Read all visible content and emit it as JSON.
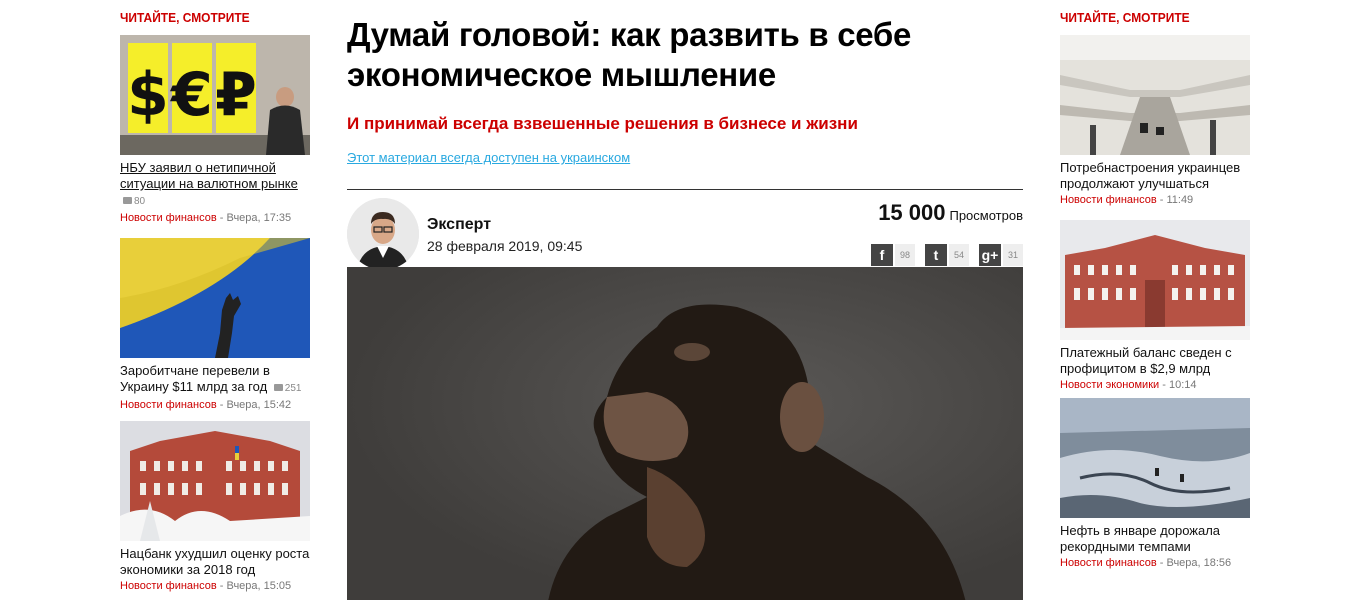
{
  "left": {
    "heading": "ЧИТАЙТЕ, СМОТРИТЕ",
    "items": [
      {
        "title": "НБУ заявил о нетипичной ситуации на валютном рынке",
        "comments": "80",
        "category": "Новости финансов",
        "sep": " - ",
        "time": "Вчера, 17:35"
      },
      {
        "title": "Заробитчане перевели в Украину $11 млрд за год",
        "comments": "251",
        "category": "Новости финансов",
        "sep": " - ",
        "time": "Вчера, 15:42"
      },
      {
        "title": "Нацбанк ухудшил оценку роста экономики за 2018 год",
        "comments": "",
        "category": "Новости финансов",
        "sep": " - ",
        "time": "Вчера, 15:05"
      }
    ]
  },
  "right": {
    "heading": "ЧИТАЙТЕ, СМОТРИТЕ",
    "items": [
      {
        "title": "Потребнастроения украинцев продолжают улучшаться",
        "category": "Новости финансов",
        "sep": " - ",
        "time": "11:49"
      },
      {
        "title": "Платежный баланс сведен с профицитом в $2,9 млрд",
        "category": "Новости экономики",
        "sep": " - ",
        "time": "10:14"
      },
      {
        "title": "Нефть в январе дорожала рекордными темпами",
        "category": "Новости финансов",
        "sep": " - ",
        "time": "Вчера, 18:56"
      }
    ]
  },
  "article": {
    "headline": "Думай головой: как развить в себе экономическое мышление",
    "subhead": "И принимай всегда взвешенные решения в бизнесе и жизни",
    "lang_link": "Этот материал всегда доступен на украинском",
    "author": "Эксперт",
    "date": "28 февраля 2019, 09:45",
    "views_num": "15 000",
    "views_label": "Просмотров",
    "shares": [
      {
        "icon": "f",
        "count": "98"
      },
      {
        "icon": "t",
        "count": "54"
      },
      {
        "icon": "g+",
        "count": "31"
      }
    ]
  },
  "thumb_images": {
    "currency": "currency exchange sign",
    "flag": "hand against Ukrainian flag",
    "bank": "National Bank building in snow",
    "mall": "shopping mall interior",
    "bank2": "National Bank building in snow",
    "oil": "aerial oil field in snow"
  }
}
